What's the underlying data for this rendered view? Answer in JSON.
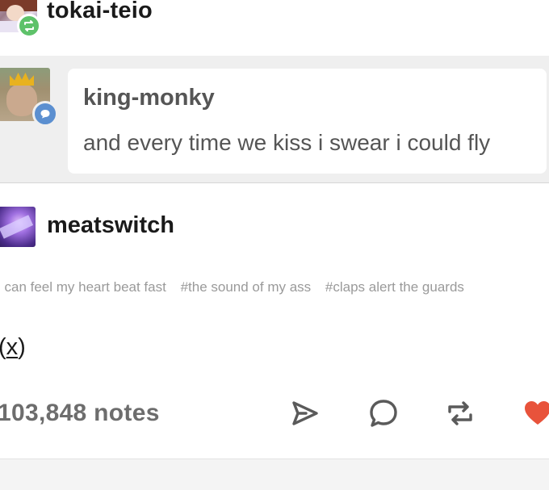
{
  "reblogger": {
    "username": "tokai-teio",
    "avatar_icon": "avatar-image",
    "badge_icon": "reblog-icon",
    "badge_color": "#5ec26a"
  },
  "quoted_post": {
    "username": "king-monky",
    "text": "and every time we kiss i swear i could fly",
    "badge_icon": "chat-bubble-icon",
    "badge_color": "#5b8fd0"
  },
  "original_post": {
    "username": "meatswitch",
    "tags": [
      "i can feel my heart beat fast",
      "#the sound of my ass",
      "#claps alert the guards"
    ],
    "source_prefix": "(",
    "source_link": "x",
    "source_suffix": ")"
  },
  "footer": {
    "notes": "103,848 notes",
    "actions": [
      {
        "name": "share",
        "icon": "send-icon"
      },
      {
        "name": "reply",
        "icon": "comment-icon"
      },
      {
        "name": "reblog",
        "icon": "reblog-icon"
      },
      {
        "name": "like",
        "icon": "heart-icon",
        "color": "#e8533b"
      }
    ]
  }
}
